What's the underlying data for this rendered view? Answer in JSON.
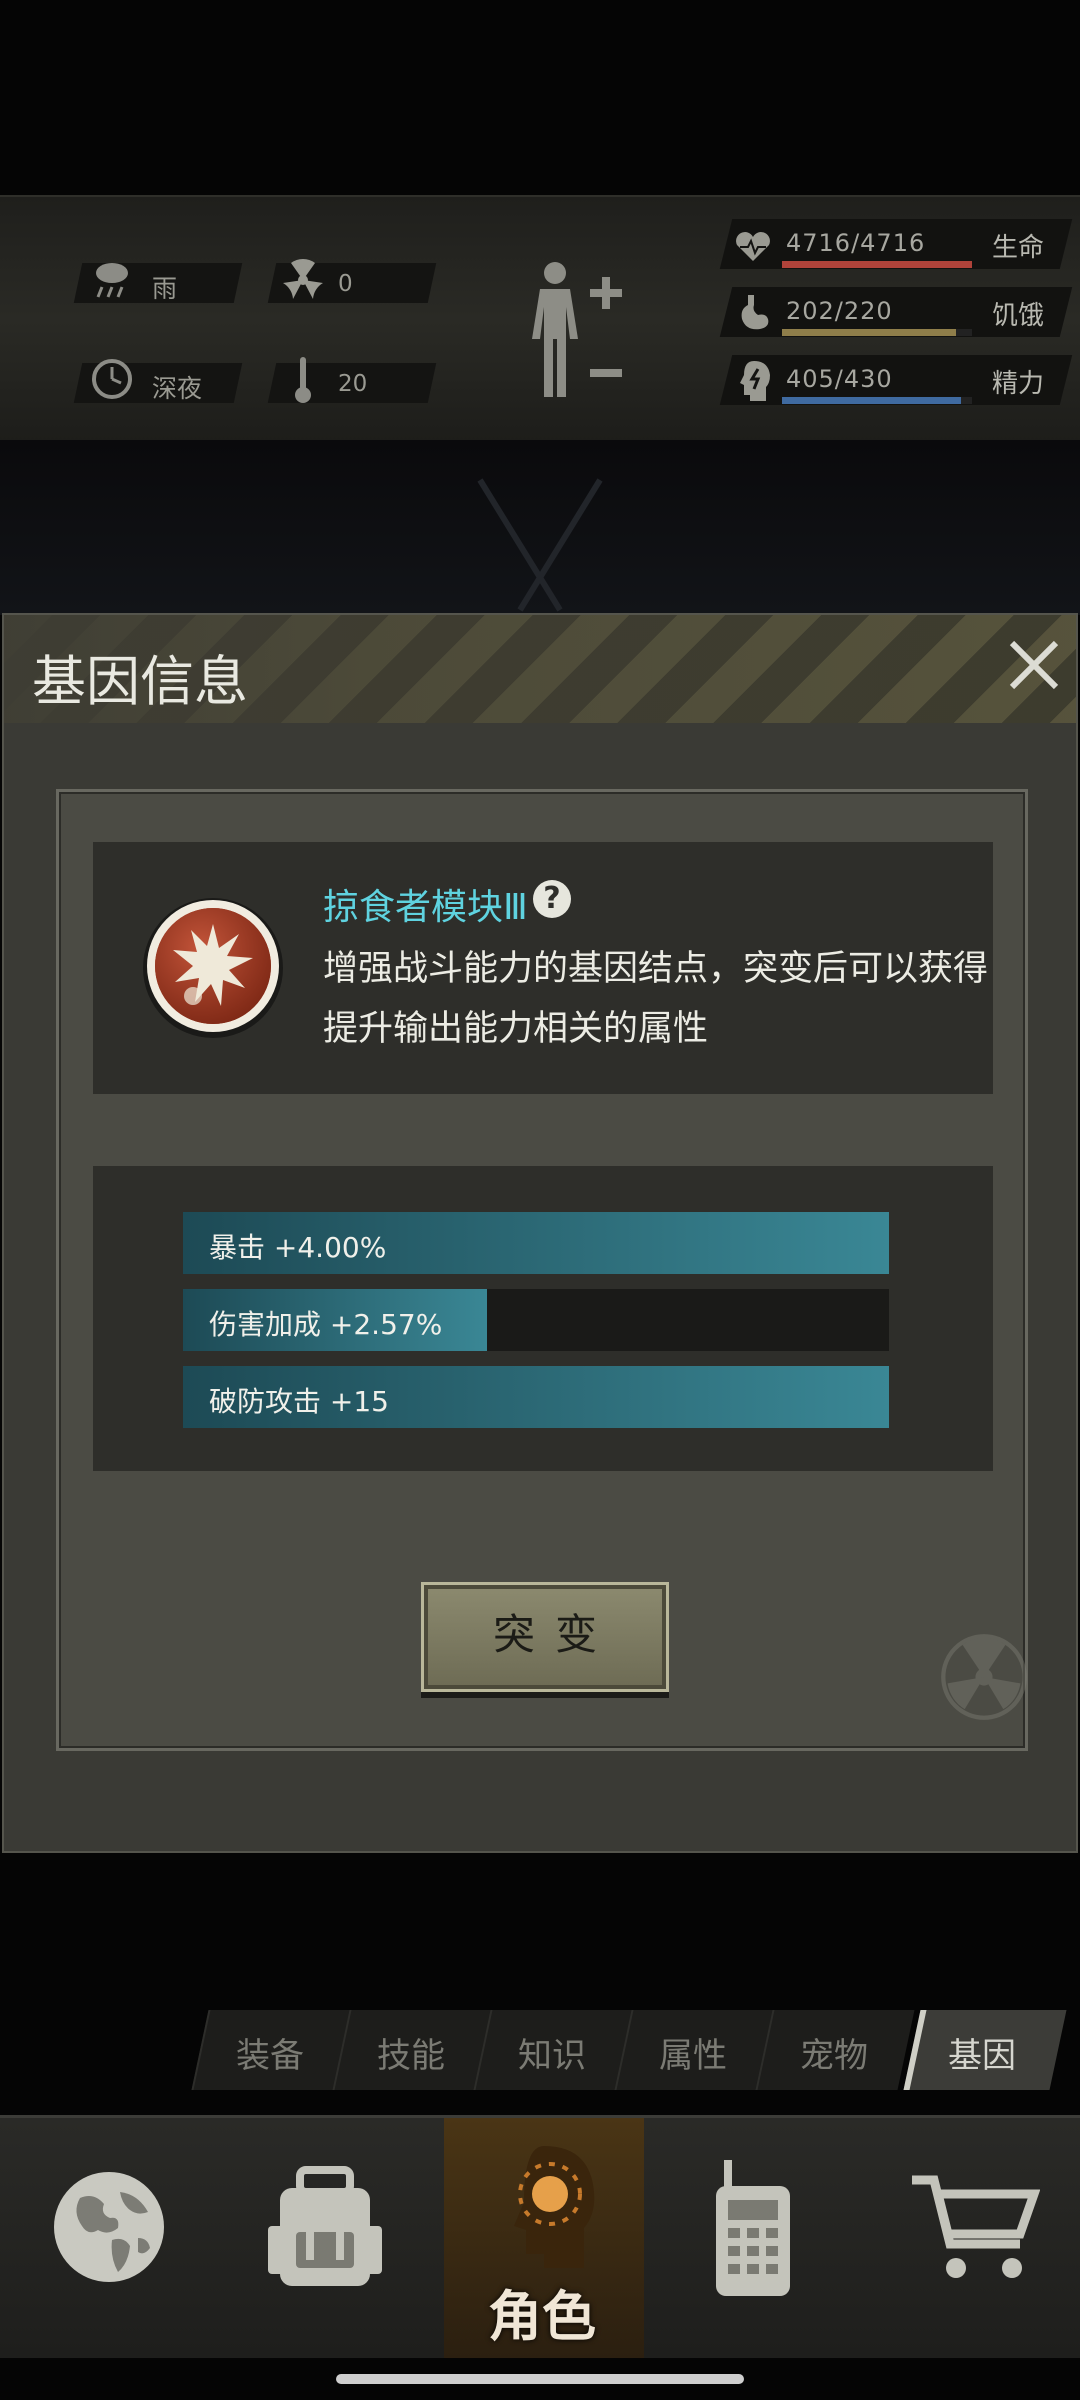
{
  "status": {
    "weather": "雨",
    "radiation": "0",
    "time_of_day": "深夜",
    "temperature": "20",
    "health": {
      "value": "4716/4716",
      "label": "生命",
      "fill": 1.0,
      "color": "#b0433a"
    },
    "hunger": {
      "value": "202/220",
      "label": "饥饿",
      "fill": 0.918,
      "color": "#8f7e4a"
    },
    "energy": {
      "value": "405/430",
      "label": "精力",
      "fill": 0.942,
      "color": "#3f6aa0"
    }
  },
  "dialog": {
    "title": "基因信息",
    "gene": {
      "name": "掠食者模块Ⅲ",
      "description_line1": "增强战斗能力的基因结点，突变后可以获得",
      "description_line2": "提升输出能力相关的属性"
    },
    "attributes": [
      {
        "label": "暴击 +4.00%",
        "fill": 1.0
      },
      {
        "label": "伤害加成 +2.57%",
        "fill": 0.43
      },
      {
        "label": "破防攻击 +15",
        "fill": 1.0
      }
    ],
    "mutate_label": "突变"
  },
  "sub_tabs": [
    {
      "label": "装备",
      "active": false
    },
    {
      "label": "技能",
      "active": false
    },
    {
      "label": "知识",
      "active": false
    },
    {
      "label": "属性",
      "active": false
    },
    {
      "label": "宠物",
      "active": false
    },
    {
      "label": "基因",
      "active": true
    }
  ],
  "bottom_nav": {
    "items": [
      {
        "icon": "globe-icon",
        "label": ""
      },
      {
        "icon": "backpack-icon",
        "label": ""
      },
      {
        "icon": "character-head-icon",
        "label": "角色",
        "active": true
      },
      {
        "icon": "radio-icon",
        "label": ""
      },
      {
        "icon": "cart-icon",
        "label": ""
      }
    ]
  }
}
